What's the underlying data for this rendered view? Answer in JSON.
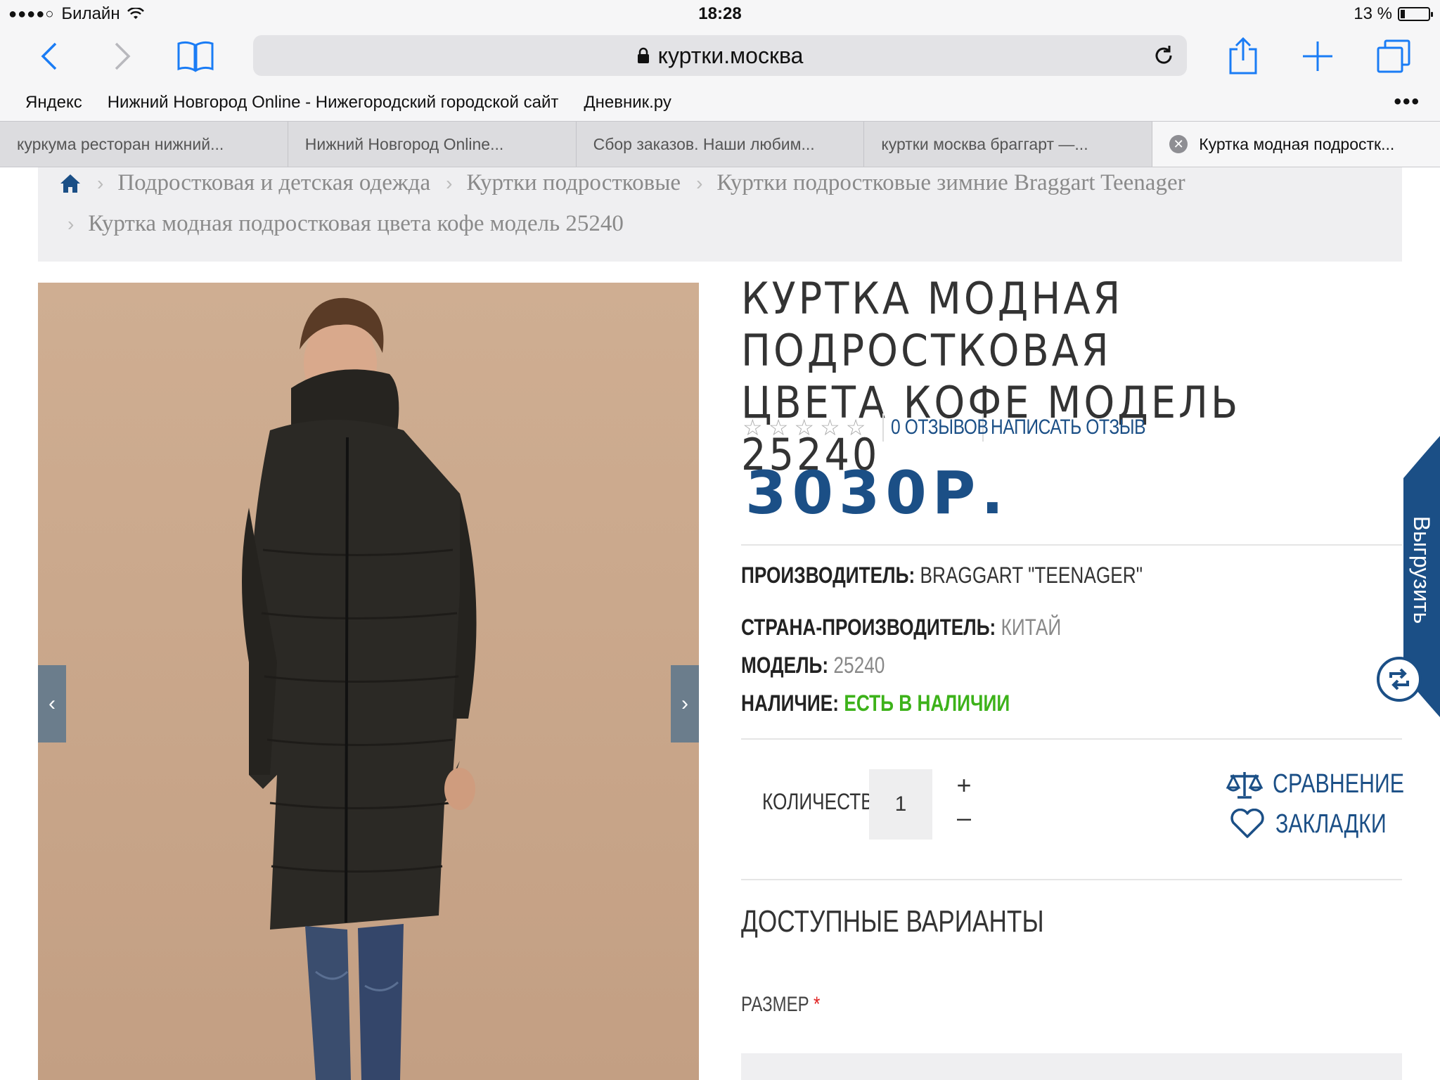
{
  "statusbar": {
    "carrier": "Билайн",
    "time": "18:28",
    "battery": "13 %"
  },
  "browser": {
    "url": "куртки.москва",
    "favorites": [
      "Яндекс",
      "Нижний Новгород Online - Нижегородский городской сайт",
      "Дневник.ру"
    ],
    "tabs": [
      "куркума ресторан нижний...",
      "Нижний Новгород Online...",
      "Сбор заказов. Наши любим...",
      "куртки москва браггарт —...",
      "Куртка модная подростк..."
    ]
  },
  "breadcrumb": {
    "items": [
      "Подростковая и детская одежда",
      "Куртки подростковые",
      "Куртки подростковые зимние Braggart Teenager",
      "Куртка модная подростковая цвета кофе модель 25240"
    ]
  },
  "product": {
    "title_line1": "Куртка модная подростковая",
    "title_line2": "цвета кофе модель 25240",
    "reviews_link": "0 отзывов",
    "write_review": "Написать отзыв",
    "rating": 0,
    "rating_max": 5,
    "price": "3030р.",
    "specs": {
      "manufacturer_label": "Производитель:",
      "manufacturer": "Braggart \"Teenager\"",
      "country_label": "Страна-производитель:",
      "country": "Китай",
      "model_label": "Модель:",
      "model": "25240",
      "availability_label": "Наличие:",
      "availability": "Есть в наличии"
    },
    "quantity_label": "Количество",
    "quantity": "1",
    "compare": "Сравнение",
    "bookmarks": "Закладки",
    "variants_heading": "Доступные варианты",
    "size_label": "Размер",
    "required_mark": "*"
  },
  "side_tab": {
    "label": "Выгрузить"
  },
  "colors": {
    "brand_blue": "#1b4f86",
    "in_stock_green": "#3db21a",
    "ios_blue": "#1a7cf5",
    "photo_bg": "#c8a78b"
  }
}
